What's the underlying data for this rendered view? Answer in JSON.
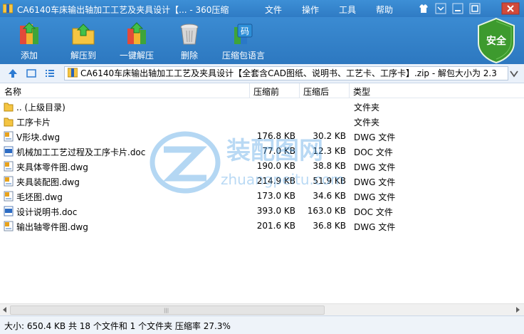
{
  "window": {
    "title": "CA6140车床输出轴加工工艺及夹具设计【... - 360压缩",
    "menu": [
      "文件",
      "操作",
      "工具",
      "帮助"
    ]
  },
  "toolbar": {
    "buttons": [
      {
        "label": "添加",
        "icon": "add-books-icon"
      },
      {
        "label": "解压到",
        "icon": "extract-folder-icon"
      },
      {
        "label": "一键解压",
        "icon": "one-click-extract-icon"
      },
      {
        "label": "删除",
        "icon": "trash-can-icon"
      },
      {
        "label": "压缩包语言",
        "icon": "language-code-icon"
      }
    ],
    "safe_label": "安全"
  },
  "address": {
    "path": "CA6140车床输出轴加工工艺及夹具设计【全套含CAD图纸、说明书、工艺卡、工序卡】.zip - 解包大小为 2.3"
  },
  "columns": {
    "name": "名称",
    "size": "压缩前",
    "compressed": "压缩后",
    "type": "类型"
  },
  "files": [
    {
      "name": ".. (上级目录)",
      "size": "",
      "compressed": "",
      "type": "文件夹",
      "icon": "folder"
    },
    {
      "name": "工序卡片",
      "size": "",
      "compressed": "",
      "type": "文件夹",
      "icon": "folder"
    },
    {
      "name": "V形块.dwg",
      "size": "176.8 KB",
      "compressed": "30.2 KB",
      "type": "DWG 文件",
      "icon": "dwg"
    },
    {
      "name": "机械加工工艺过程及工序卡片.doc",
      "size": "77.0 KB",
      "compressed": "12.3 KB",
      "type": "DOC 文件",
      "icon": "doc"
    },
    {
      "name": "夹具体零件图.dwg",
      "size": "190.0 KB",
      "compressed": "38.8 KB",
      "type": "DWG 文件",
      "icon": "dwg"
    },
    {
      "name": "夹具装配图.dwg",
      "size": "214.9 KB",
      "compressed": "51.9 KB",
      "type": "DWG 文件",
      "icon": "dwg"
    },
    {
      "name": "毛坯图.dwg",
      "size": "173.0 KB",
      "compressed": "34.6 KB",
      "type": "DWG 文件",
      "icon": "dwg"
    },
    {
      "name": "设计说明书.doc",
      "size": "393.0 KB",
      "compressed": "163.0 KB",
      "type": "DOC 文件",
      "icon": "doc"
    },
    {
      "name": "输出轴零件图.dwg",
      "size": "201.6 KB",
      "compressed": "36.8 KB",
      "type": "DWG 文件",
      "icon": "dwg"
    }
  ],
  "watermark": {
    "brand": "装配图网",
    "url": "zhuangpeitu.com"
  },
  "status": {
    "text": "大小: 650.4 KB 共 18 个文件和 1 个文件夹 压缩率 27.3%"
  },
  "colors": {
    "toolbar_blue": "#2f7bc4",
    "safe_green": "#3d9a2e",
    "watermark_blue": "#5aa7e6"
  }
}
